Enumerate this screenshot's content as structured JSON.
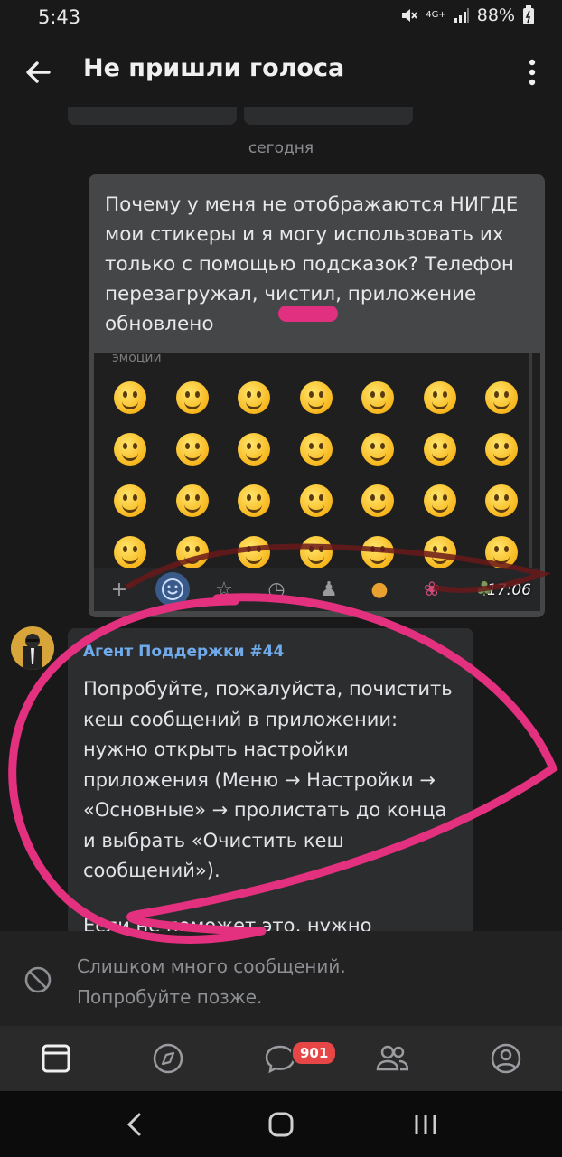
{
  "status_bar": {
    "time": "5:43",
    "network": "4G+",
    "battery": "88%"
  },
  "header": {
    "title": "Не пришли голоса"
  },
  "date_separator": "сегодня",
  "user_message": {
    "text": "Почему у меня не отображаются НИГДЕ мои стикеры и я могу использовать их только с помощью подсказок? Телефон перезагружал, чистил, приложение обновлено",
    "screenshot_category": "эмоции",
    "time": "17:06"
  },
  "agent_message": {
    "name": "Агент Поддержки #44",
    "paragraphs": [
      "Попробуйте, пожалуйста, почистить кеш сообщений в приложении: нужно открыть настройки приложения (Меню → Настройки → «Основные» → пролистать до конца и выбрать «Очистить кеш сообщений»)."
    ],
    "truncated": "Если не поможет это, нужно"
  },
  "restriction": {
    "line1": "Слишком много сообщений.",
    "line2": "Попробуйте позже."
  },
  "tabbar": {
    "messages_badge": "901"
  },
  "colors": {
    "accent_link": "#71aaeb",
    "marker": "#e0307f",
    "badge": "#e64646"
  }
}
